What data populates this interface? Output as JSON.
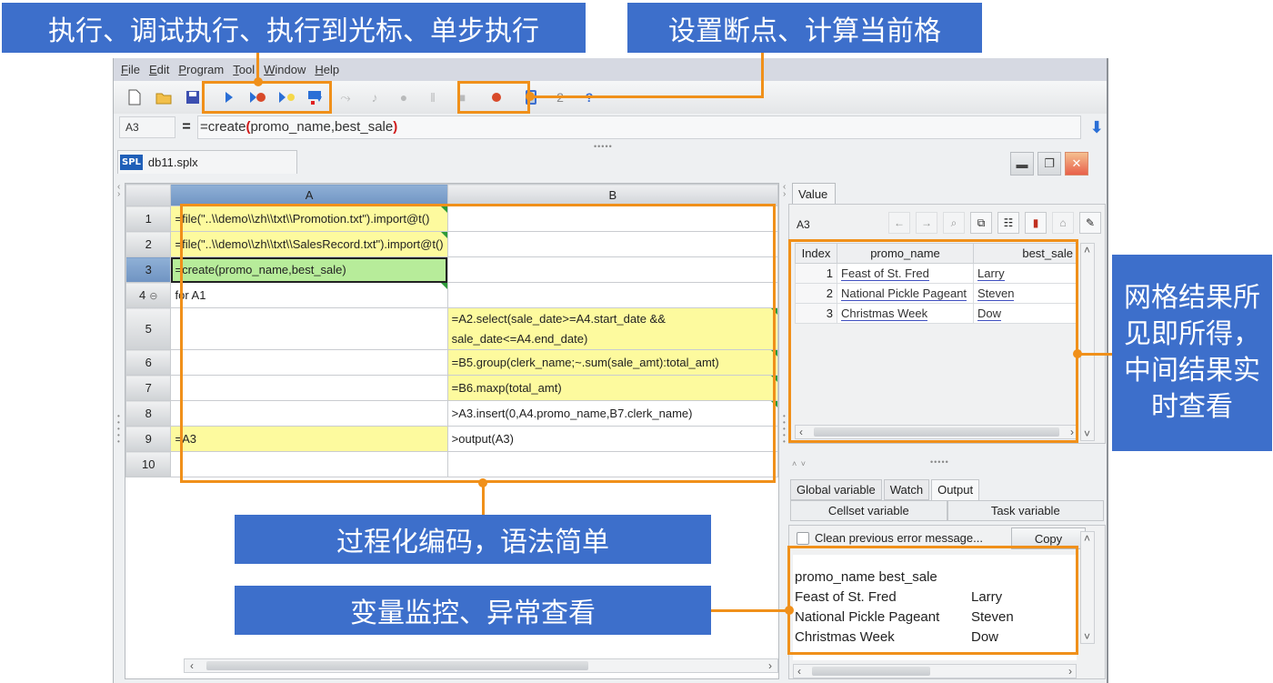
{
  "callouts": {
    "run_tools": "执行、调试执行、执行到光标、单步执行",
    "breakpoint_tools": "设置断点、计算当前格",
    "grid_result": "网格结果所见即所得，中间结果实时查看",
    "procedural": "过程化编码，语法简单",
    "monitoring": "变量监控、异常查看"
  },
  "menu": [
    {
      "label": "File",
      "ul": "F",
      "rest": "ile"
    },
    {
      "label": "Edit",
      "ul": "E",
      "rest": "dit"
    },
    {
      "label": "Program",
      "ul": "P",
      "rest": "rogram"
    },
    {
      "label": "Tool",
      "ul": "T",
      "rest": "ool"
    },
    {
      "label": "Window",
      "ul": "W",
      "rest": "indow"
    },
    {
      "label": "Help",
      "ul": "H",
      "rest": "elp"
    }
  ],
  "toolbar": {
    "icons": [
      "new-file",
      "open-folder",
      "save",
      "run",
      "debug-run",
      "run-to-cursor",
      "step",
      "step-over",
      "step-into",
      "continue",
      "pause",
      "stop",
      "toggle-breakpoint",
      "calculate-cell",
      "undo-2",
      "help"
    ]
  },
  "formula_bar": {
    "cell_ref": "A3",
    "equals": "=",
    "prefix": "=create",
    "open_paren": "(",
    "args": "promo_name,best_sale",
    "close_paren": ")"
  },
  "file_tab": {
    "badge": "SPL",
    "name": "db11.splx"
  },
  "grid": {
    "columns": [
      "A",
      "B"
    ],
    "rows": [
      {
        "n": "1",
        "a": "=file(\"..\\\\demo\\\\zh\\\\txt\\\\Promotion.txt\").import@t()",
        "b": ""
      },
      {
        "n": "2",
        "a": "=file(\"..\\\\demo\\\\zh\\\\txt\\\\SalesRecord.txt\").import@t()",
        "b": ""
      },
      {
        "n": "3",
        "a": "=create(promo_name,best_sale)",
        "b": ""
      },
      {
        "n": "4",
        "a": "for A1",
        "b": ""
      },
      {
        "n": "5",
        "a": "",
        "b": "=A2.select(sale_date>=A4.start_date && sale_date<=A4.end_date)"
      },
      {
        "n": "6",
        "a": "",
        "b": "=B5.group(clerk_name;~.sum(sale_amt):total_amt)"
      },
      {
        "n": "7",
        "a": "",
        "b": "=B6.maxp(total_amt)"
      },
      {
        "n": "8",
        "a": "",
        "b": ">A3.insert(0,A4.promo_name,B7.clerk_name)"
      },
      {
        "n": "9",
        "a": "=A3",
        "b": ">output(A3)"
      },
      {
        "n": "10",
        "a": "",
        "b": ""
      }
    ]
  },
  "value_panel": {
    "tab": "Value",
    "cell_ref": "A3",
    "headers": [
      "Index",
      "promo_name",
      "best_sale"
    ],
    "rows": [
      {
        "index": "1",
        "promo_name": "Feast of St. Fred",
        "best_sale": "Larry"
      },
      {
        "index": "2",
        "promo_name": "National Pickle Pageant",
        "best_sale": "Steven"
      },
      {
        "index": "3",
        "promo_name": "Christmas Week",
        "best_sale": "Dow"
      }
    ]
  },
  "lower_panel": {
    "tabs": [
      "Global variable",
      "Watch",
      "Output"
    ],
    "active_tab": "Output",
    "sub_tabs": [
      "Cellset variable",
      "Task variable"
    ],
    "clean_checkbox_label": "Clean previous error message...",
    "copy_label": "Copy",
    "output_header": "promo_name best_sale",
    "output_rows": [
      [
        "Feast of St. Fred",
        "Larry"
      ],
      [
        "National Pickle Pageant",
        "Steven"
      ],
      [
        "Christmas Week",
        "Dow"
      ]
    ]
  }
}
